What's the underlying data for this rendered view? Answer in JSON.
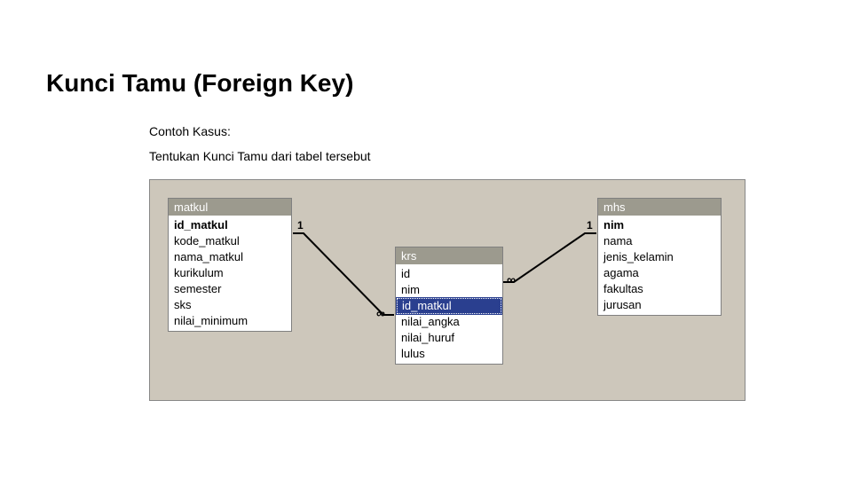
{
  "title": "Kunci Tamu (Foreign Key)",
  "subtitle": "Contoh Kasus:",
  "instruction": "Tentukan Kunci Tamu dari tabel tersebut",
  "tables": {
    "matkul": {
      "name": "matkul",
      "fields": [
        "id_matkul",
        "kode_matkul",
        "nama_matkul",
        "kurikulum",
        "semester",
        "sks",
        "nilai_minimum"
      ],
      "pk": "id_matkul"
    },
    "krs": {
      "name": "krs",
      "fields": [
        "id",
        "nim",
        "id_matkul",
        "nilai_angka",
        "nilai_huruf",
        "lulus"
      ],
      "selected": "id_matkul"
    },
    "mhs": {
      "name": "mhs",
      "fields": [
        "nim",
        "nama",
        "jenis_kelamin",
        "agama",
        "fakultas",
        "jurusan"
      ],
      "pk": "nim"
    }
  },
  "rel": {
    "left_one": "1",
    "left_many": "∞",
    "right_one": "1",
    "right_many": "∞"
  }
}
